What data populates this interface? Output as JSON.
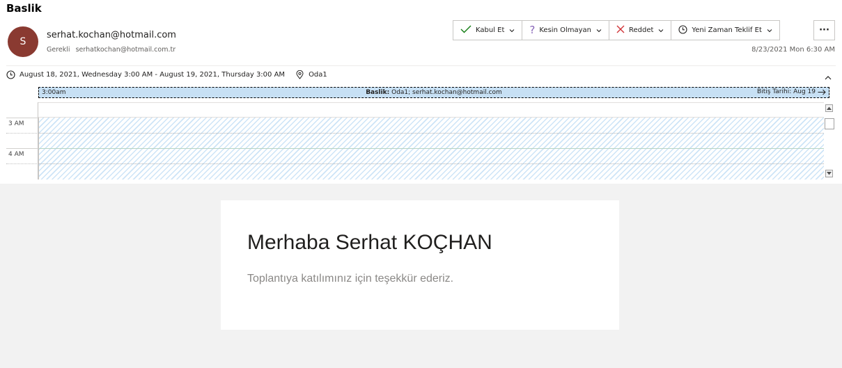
{
  "message": {
    "subject": "Baslik",
    "sender": {
      "initial": "S",
      "email": "serhat.kochan@hotmail.com",
      "avatar_color": "#8a3a31"
    },
    "required_label": "Gerekli",
    "required_attendee": "serhatkochan@hotmail.com.tr",
    "received": "8/23/2021 Mon 6:30 AM"
  },
  "actions": {
    "accept": "Kabul Et",
    "tentative": "Kesin Olmayan",
    "decline": "Reddet",
    "propose": "Yeni Zaman Teklif Et",
    "more": "···"
  },
  "meeting": {
    "time_range": "August 18, 2021, Wednesday 3:00 AM - August 19, 2021, Thursday 3:00 AM",
    "location": "Oda1"
  },
  "calendar": {
    "event_start": "3:00am",
    "event_title_label": "Baslik:",
    "event_details": "Oda1; serhat.kochan@hotmail.com",
    "event_end": "Bitiş Tarihi: Aug 19",
    "hours": [
      "3 AM",
      "4 AM"
    ]
  },
  "body": {
    "greeting": "Merhaba Serhat KOÇHAN",
    "thanks": "Toplantıya katılımınız için teşekkür ederiz."
  },
  "icons": {
    "accept": "check-icon",
    "tentative": "question-icon",
    "decline": "x-icon",
    "propose": "clock-icon",
    "location": "map-pin-icon"
  },
  "colors": {
    "accept": "#107c10",
    "tentative": "#8764b8",
    "decline": "#d13438",
    "event_fill": "#c7e0f4",
    "body_bg": "#f2f2f2"
  }
}
